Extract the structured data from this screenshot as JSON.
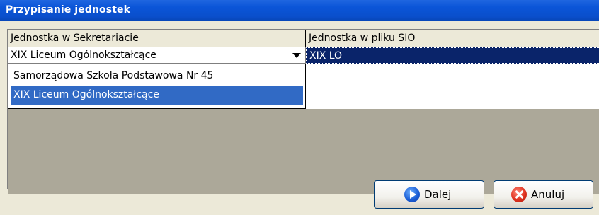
{
  "window": {
    "title": "Przypisanie jednostek"
  },
  "grid": {
    "columns": [
      "Jednostka w Sekretariacie",
      "Jednostka w pliku SIO"
    ],
    "rows": [
      {
        "left": "XIX Liceum Ogólnokształcące",
        "right": "XIX LO"
      }
    ]
  },
  "dropdown": {
    "options": [
      "Samorządowa Szkoła Podstawowa Nr 45",
      "XIX Liceum Ogólnokształcące"
    ],
    "selected_index": 1
  },
  "buttons": {
    "next_label": "Dalej",
    "cancel_label": "Anuluj"
  },
  "icons": {
    "next": "arrow-right-icon",
    "cancel": "close-icon"
  }
}
